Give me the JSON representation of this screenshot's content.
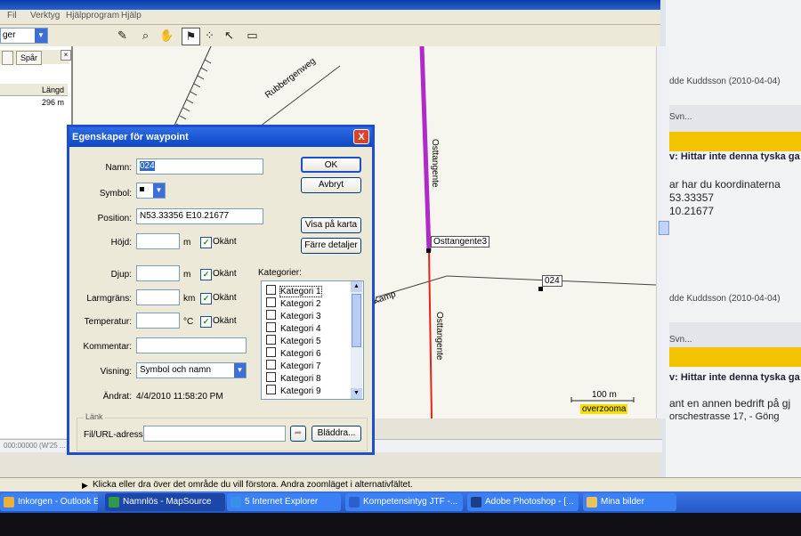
{
  "mapsource_menu": [
    "Fil",
    "Verktyg",
    "Hjälpprogram",
    "Hjälp"
  ],
  "left_panel": {
    "combo_value": "ger",
    "tab_label": "Spår",
    "column_header": "Längd",
    "row_value": "296 m",
    "hscroll_text": "000:00000 (W'25 ..."
  },
  "map": {
    "street_1": "Rubbergenweg",
    "street_2": "Osttangente",
    "street_3": "Osttangente",
    "street_4": "Kamp",
    "waypoint_label_1": "Osttangente3",
    "waypoint_label_2": "024",
    "scale_text": "100 m",
    "overzoom_text": "overzooma",
    "colors": {
      "track": "#b02ac8",
      "route": "#e8231a",
      "background": "#f7f6ee"
    }
  },
  "browser": {
    "line_1": "dde Kuddsson (2010-04-04)",
    "line_2": "Svn...",
    "line_3": "v: Hittar inte denna tyska ga",
    "line_4": "ar har du koordinaterna",
    "line_5": "53.33357",
    "line_6": "10.21677",
    "line_7": "dde Kuddsson (2010-04-04)",
    "line_8": "Svn...",
    "line_9": "v: Hittar inte denna tyska ga",
    "line_10": "ant en annen bedrift på gj",
    "line_11": "orschestrasse 17, - Göng"
  },
  "dialog": {
    "title": "Egenskaper för waypoint",
    "close": "X",
    "name_label": "Namn:",
    "name_value": "024",
    "symbol_label": "Symbol:",
    "position_label": "Position:",
    "position_value": "N53.33356 E10.21677",
    "hojd_label": "Höjd:",
    "hojd_unit": "m",
    "djup_label": "Djup:",
    "djup_unit": "m",
    "larm_label": "Larmgräns:",
    "larm_unit": "km",
    "temp_label": "Temperatur:",
    "temp_unit": "°C",
    "okant": "Okänt",
    "kommentar_label": "Kommentar:",
    "visning_label": "Visning:",
    "visning_value": "Symbol och namn",
    "andrat_label": "Ändrat:",
    "andrat_value": "4/4/2010 11:58:20 PM",
    "ok_button": "OK",
    "cancel_button": "Avbryt",
    "show_on_map_button": "Visa på karta",
    "fewer_details_button": "Färre detaljer",
    "categories_label": "Kategorier:",
    "categories": [
      "Kategori 1",
      "Kategori 2",
      "Kategori 3",
      "Kategori 4",
      "Kategori 5",
      "Kategori 6",
      "Kategori 7",
      "Kategori 8",
      "Kategori 9"
    ],
    "link_group_label": "Länk",
    "file_url_label": "Fil/URL-adress:",
    "browse_button": "Bläddra..."
  },
  "status_text": "Klicka eller dra över det område du vill förstora. Andra zoomläget i alternativfältet.",
  "taskbar": [
    {
      "label": "Inkorgen - Outlook E...",
      "color": "#e9b23a"
    },
    {
      "label": "Namnlös - MapSource",
      "color": "#2e9b4a"
    },
    {
      "label": "5 Internet Explorer",
      "color": "#3a8fe6"
    },
    {
      "label": "Kompetensintyg JTF -...",
      "color": "#2b5fcf"
    },
    {
      "label": "Adobe Photoshop - [...",
      "color": "#1d3f8a"
    },
    {
      "label": "Mina bilder",
      "color": "#e8c35a"
    }
  ]
}
